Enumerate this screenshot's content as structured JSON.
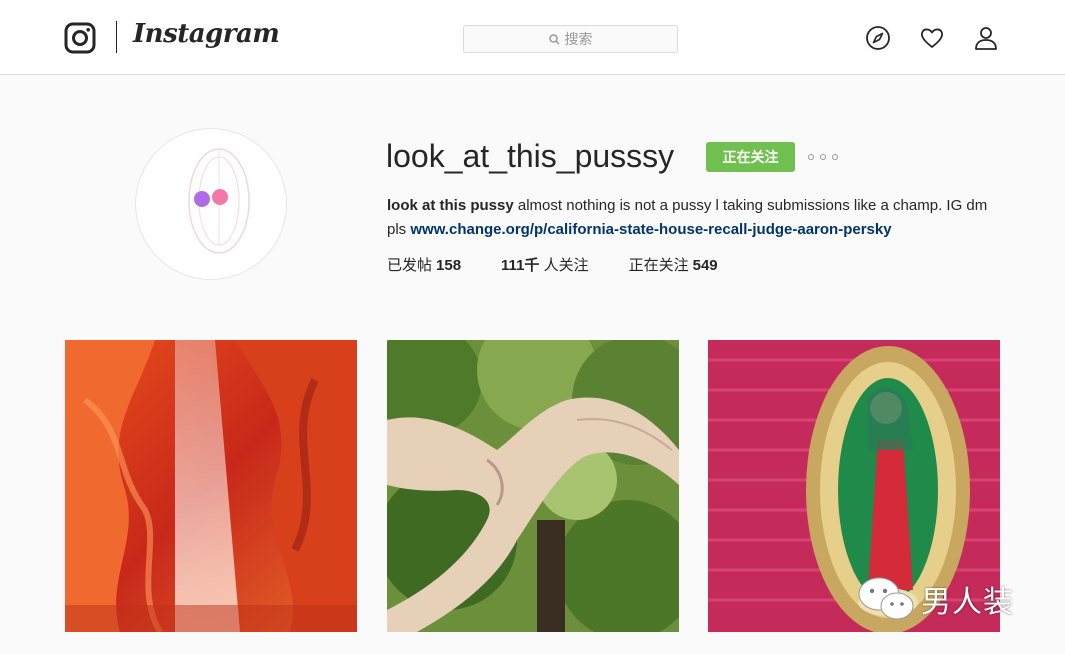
{
  "header": {
    "brand": "Instagram",
    "search_placeholder": "搜索",
    "nav": [
      "compass-icon",
      "heart-icon",
      "user-icon"
    ]
  },
  "profile": {
    "username": "look_at_this_pusssy",
    "follow_label": "正在关注",
    "bio_name": "look at this pussy",
    "bio_text": "almost nothing is not a pussy l taking submissions like a champ. IG dm pls",
    "bio_link": "www.change.org/p/california-state-house-recall-judge-aaron-persky",
    "stats": {
      "posts_label": "已发帖",
      "posts_count": "158",
      "followers_count": "111千",
      "followers_label": "人关注",
      "following_label": "正在关注",
      "following_count": "549"
    }
  },
  "posts": [
    {
      "subject": "red slot canyon with light beam"
    },
    {
      "subject": "pale tree trunk against green foliage"
    },
    {
      "subject": "sequined Virgin of Guadalupe patch on pink fabric"
    }
  ],
  "watermark": {
    "text": "男人装"
  },
  "colors": {
    "follow_green": "#70c050",
    "link_blue": "#003569",
    "border": "#dbdbdb",
    "background": "#fafafa"
  }
}
